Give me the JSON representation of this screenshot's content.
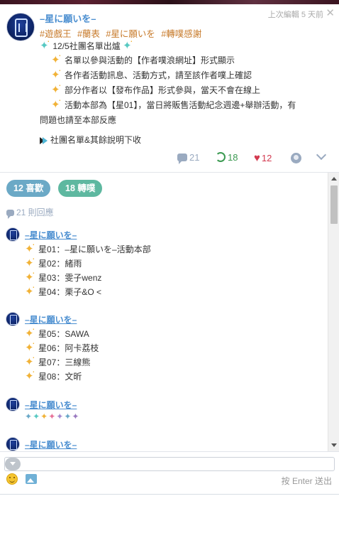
{
  "post": {
    "author": "–星に願いを–",
    "timestamp": "上次編輯 5 天前",
    "menu_glyph": "✕",
    "tags": [
      "#遊戲王",
      "#蘭表",
      "#星に願いを",
      "#轉噗感謝"
    ],
    "heading": "12/5社團名單出爐",
    "bullets": [
      "名單以參與活動的【作者噗浪網址】形式顯示",
      "各作者活動訊息、活動方式，請至該作者噗上確認",
      "部分作者以【發布作品】形式參與，當天不會在線上",
      "活動本部為【星01】，當日將販售活動紀念週邊+舉辦活動，有"
    ],
    "bullet_continuation": "問題也請至本部反應",
    "collapse_note": "社團名單&其餘說明下收",
    "stats": {
      "comments": "21",
      "shares": "18",
      "likes": "12"
    },
    "colors": {
      "author_blue": "#4a8ed0",
      "tag_orange": "#c77a2a",
      "share_green": "#3c9a52",
      "like_red": "#d33a50"
    }
  },
  "thread": {
    "likes_pill": "12 喜歡",
    "shares_pill": "18 轉噗",
    "replies_count": "21 則回應",
    "replies": [
      {
        "author": "–星に願いを–",
        "lines": [
          {
            "label": "星01：",
            "value": "–星に願いを–活動本部"
          },
          {
            "label": "星02：",
            "value": "緒雨"
          },
          {
            "label": "星03：",
            "value": "雯子wenz"
          },
          {
            "label": "星04：",
            "value": "栗子&O <"
          }
        ]
      },
      {
        "author": "–星に願いを–",
        "lines": [
          {
            "label": "星05：",
            "value": "SAWA"
          },
          {
            "label": "星06：",
            "value": "阿卡荔枝"
          },
          {
            "label": "星07：",
            "value": "三線熊"
          },
          {
            "label": "星08：",
            "value": "文昕"
          }
        ]
      },
      {
        "author": "–星に願いを–",
        "sparkles": "✦✦✦✦✦✦✦"
      },
      {
        "author": "–星に願いを–"
      }
    ]
  },
  "composer": {
    "placeholder": "",
    "send_hint": "按 Enter 送出"
  },
  "icons": {
    "comment": "comment-bubble-icon",
    "share": "replurk-icon",
    "like": "heart-icon",
    "mute": "mute-icon",
    "expand": "chevron-down-icon",
    "emoji": "emoji-icon",
    "image": "image-icon"
  }
}
